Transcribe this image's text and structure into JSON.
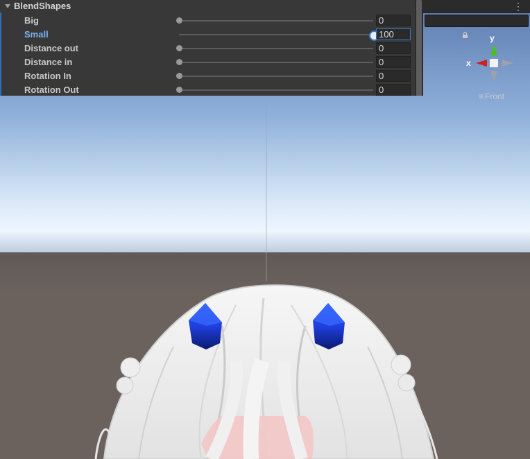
{
  "inspector": {
    "section_title": "BlendShapes",
    "rows": [
      {
        "label": "Big",
        "value": "0",
        "fraction": 0.0,
        "active": false
      },
      {
        "label": "Small",
        "value": "100",
        "fraction": 1.0,
        "active": true
      },
      {
        "label": "Distance out",
        "value": "0",
        "fraction": 0.0,
        "active": false
      },
      {
        "label": "Distance in",
        "value": "0",
        "fraction": 0.0,
        "active": false
      },
      {
        "label": "Rotation In",
        "value": "0",
        "fraction": 0.0,
        "active": false
      },
      {
        "label": "Rotation Out",
        "value": "0",
        "fraction": 0.0,
        "active": false
      }
    ]
  },
  "toolbar": {
    "more_label": "⋮"
  },
  "gizmo": {
    "y_label": "y",
    "x_label": "x",
    "view_mode": "Front",
    "menu_glyph": "≡"
  },
  "colors": {
    "accent": "#3a79c9",
    "horn": "#1e44e0",
    "sky_top": "#5f7fb4",
    "horizon": "#eef6ff",
    "ground": "#6b625e",
    "hair": "#f2f2f2",
    "axis_x": "#d02020",
    "axis_y": "#4ac21c"
  },
  "icons": [
    "fold-arrow-icon",
    "more-menu-icon",
    "lock-icon",
    "hamburger-icon"
  ]
}
